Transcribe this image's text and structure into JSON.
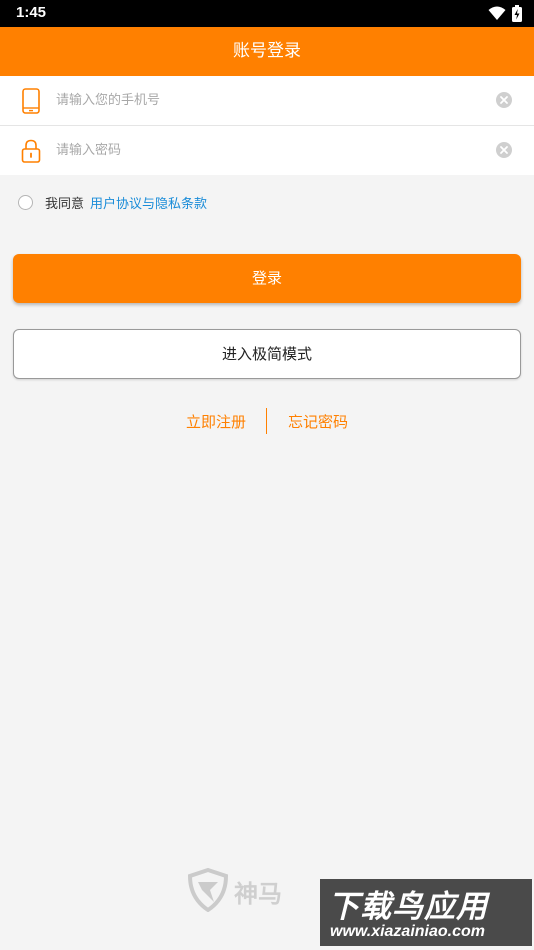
{
  "status_bar": {
    "time": "1:45",
    "icons": [
      "wifi-icon",
      "battery-icon"
    ]
  },
  "app_bar": {
    "title": "账号登录"
  },
  "form": {
    "phone": {
      "placeholder": "请输入您的手机号",
      "value": "",
      "icon": "phone-icon"
    },
    "password": {
      "placeholder": "请输入密码",
      "value": "",
      "icon": "lock-icon"
    }
  },
  "agreement": {
    "checked": false,
    "text": "我同意",
    "link_text": "用户协议与隐私条款"
  },
  "buttons": {
    "login": "登录",
    "simple_mode": "进入极简模式"
  },
  "links": {
    "register": "立即注册",
    "forgot_password": "忘记密码"
  },
  "watermarks": {
    "brand_cn": "神马",
    "xiazai_cn": "下载鸟应用",
    "xiazai_url": "www.xiazainiao.com"
  },
  "colors": {
    "accent": "#ff8000",
    "link": "#1a8cd8",
    "background": "#f4f4f4"
  }
}
